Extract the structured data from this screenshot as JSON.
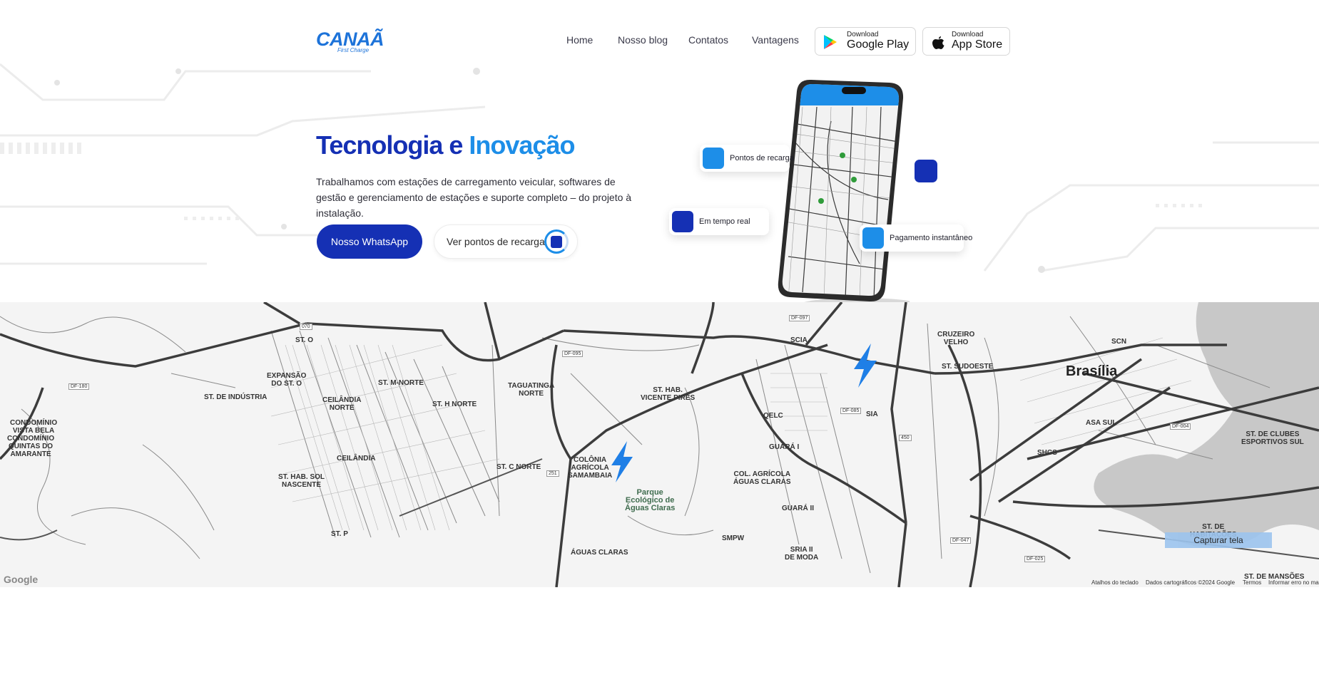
{
  "brand": {
    "name": "CANAÃ",
    "tagline": "First Charge",
    "color": "#1d73d9"
  },
  "nav": {
    "items": [
      "Home",
      "Nosso blog",
      "Contatos",
      "Vantagens"
    ]
  },
  "stores": {
    "google": {
      "small": "Download",
      "big": "Google Play",
      "icon": "google-play-icon"
    },
    "apple": {
      "small": "Download",
      "big": "App Store",
      "icon": "apple-icon"
    }
  },
  "hero": {
    "title_part1": "Tecnologia",
    "title_part2": " e ",
    "title_part3": "Inovação",
    "description": "Trabalhamos com estações de carregamento veicular, softwares de gestão e gerenciamento de estações e suporte completo – do projeto à instalação.",
    "whatsapp_label": "Nosso WhatsApp",
    "points_label": "Ver pontos de recarga"
  },
  "features": {
    "card1": "Pontos de recarga",
    "card2": "Em tempo real",
    "card3": "Pagamento instantâneo"
  },
  "colors": {
    "primary": "#1530b4",
    "accent": "#1d8ee8",
    "bolt": "#1f7fe6"
  },
  "map": {
    "city": "Brasília",
    "labels": {
      "st_m_norte": "ST. M-NORTE",
      "taguatinga_norte": "TAGUATINGA\nNORTE",
      "st_hab_vicente_pires": "ST. HAB.\nVICENTE PIRES",
      "scia": "SCIA",
      "st_sudoeste": "ST. SUDOESTE",
      "sia": "SIA",
      "guara_i": "GUARÁ I",
      "guara_ii": "GUARÁ II",
      "asa_sul": "ASA SUL",
      "shcs": "SHCS",
      "st_industria": "ST. DE INDÚSTRIA",
      "ceilandia_norte": "CEILÂNDIA\nNORTE",
      "ceilandia": "CEILÂNDIA",
      "expansao": "EXPANSÃO\nDO ST. O",
      "st_o": "ST. O",
      "st_h_norte": "ST. H NORTE",
      "st_c_norte": "ST. C NORTE",
      "colonia_samambaia": "COLÔNIA\nAGRÍCOLA\nSAMAMBAIA",
      "parque": "Parque\nEcológico de\nÁguas Claras",
      "aguas_claras": "ÁGUAS CLARAS",
      "col_aguas_claras": "COL. AGRÍCOLA\nÁGUAS CLARAS",
      "st_hab_sol": "ST. HAB. SOL\nNASCENTE",
      "st_p": "ST. P",
      "condominio_vista": "CONDOMÍNIO\nVISTA BELA",
      "condominio_quintas": "CONDOMÍNIO\nQUINTAS DO\nAMARANTE",
      "cruzeiro": "CRUZEIRO\nVELHO",
      "st_clubes": "ST. DE CLUBES\nESPORTIVOS SUL",
      "st_habitacoes": "ST. DE\nHABITAÇÕES",
      "st_mansoes": "ST. DE MANSÕES",
      "scn": "SCN",
      "qelc": "QELC",
      "smpw": "SMPW",
      "sria": "SRIA II\nDE MODA"
    },
    "roads": [
      "070",
      "DF-180",
      "DF-095",
      "DF-097",
      "DF-085",
      "DF-087",
      "DF-075",
      "DF-047",
      "DF-004",
      "DF-025",
      "450",
      "251"
    ],
    "google": "Google",
    "footer": {
      "shortcuts": "Atalhos do teclado",
      "data": "Dados cartográficos ©2024 Google",
      "terms": "Termos",
      "report": "Informar erro no mapa"
    },
    "capture": "Capturar tela"
  }
}
